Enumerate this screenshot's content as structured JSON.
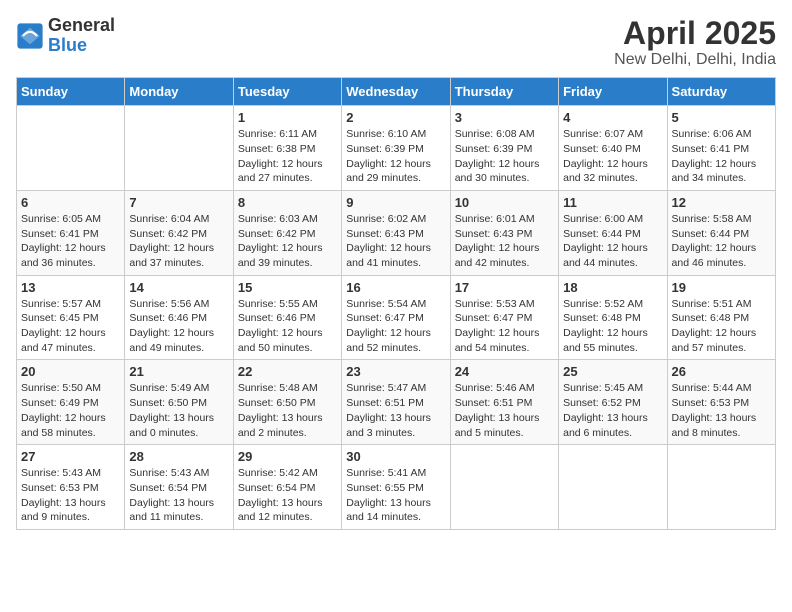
{
  "header": {
    "logo_text_general": "General",
    "logo_text_blue": "Blue",
    "title": "April 2025",
    "subtitle": "New Delhi, Delhi, India"
  },
  "calendar": {
    "days_of_week": [
      "Sunday",
      "Monday",
      "Tuesday",
      "Wednesday",
      "Thursday",
      "Friday",
      "Saturday"
    ],
    "weeks": [
      [
        {
          "day": "",
          "info": ""
        },
        {
          "day": "",
          "info": ""
        },
        {
          "day": "1",
          "sunrise": "6:11 AM",
          "sunset": "6:38 PM",
          "daylight": "12 hours and 27 minutes."
        },
        {
          "day": "2",
          "sunrise": "6:10 AM",
          "sunset": "6:39 PM",
          "daylight": "12 hours and 29 minutes."
        },
        {
          "day": "3",
          "sunrise": "6:08 AM",
          "sunset": "6:39 PM",
          "daylight": "12 hours and 30 minutes."
        },
        {
          "day": "4",
          "sunrise": "6:07 AM",
          "sunset": "6:40 PM",
          "daylight": "12 hours and 32 minutes."
        },
        {
          "day": "5",
          "sunrise": "6:06 AM",
          "sunset": "6:41 PM",
          "daylight": "12 hours and 34 minutes."
        }
      ],
      [
        {
          "day": "6",
          "sunrise": "6:05 AM",
          "sunset": "6:41 PM",
          "daylight": "12 hours and 36 minutes."
        },
        {
          "day": "7",
          "sunrise": "6:04 AM",
          "sunset": "6:42 PM",
          "daylight": "12 hours and 37 minutes."
        },
        {
          "day": "8",
          "sunrise": "6:03 AM",
          "sunset": "6:42 PM",
          "daylight": "12 hours and 39 minutes."
        },
        {
          "day": "9",
          "sunrise": "6:02 AM",
          "sunset": "6:43 PM",
          "daylight": "12 hours and 41 minutes."
        },
        {
          "day": "10",
          "sunrise": "6:01 AM",
          "sunset": "6:43 PM",
          "daylight": "12 hours and 42 minutes."
        },
        {
          "day": "11",
          "sunrise": "6:00 AM",
          "sunset": "6:44 PM",
          "daylight": "12 hours and 44 minutes."
        },
        {
          "day": "12",
          "sunrise": "5:58 AM",
          "sunset": "6:44 PM",
          "daylight": "12 hours and 46 minutes."
        }
      ],
      [
        {
          "day": "13",
          "sunrise": "5:57 AM",
          "sunset": "6:45 PM",
          "daylight": "12 hours and 47 minutes."
        },
        {
          "day": "14",
          "sunrise": "5:56 AM",
          "sunset": "6:46 PM",
          "daylight": "12 hours and 49 minutes."
        },
        {
          "day": "15",
          "sunrise": "5:55 AM",
          "sunset": "6:46 PM",
          "daylight": "12 hours and 50 minutes."
        },
        {
          "day": "16",
          "sunrise": "5:54 AM",
          "sunset": "6:47 PM",
          "daylight": "12 hours and 52 minutes."
        },
        {
          "day": "17",
          "sunrise": "5:53 AM",
          "sunset": "6:47 PM",
          "daylight": "12 hours and 54 minutes."
        },
        {
          "day": "18",
          "sunrise": "5:52 AM",
          "sunset": "6:48 PM",
          "daylight": "12 hours and 55 minutes."
        },
        {
          "day": "19",
          "sunrise": "5:51 AM",
          "sunset": "6:48 PM",
          "daylight": "12 hours and 57 minutes."
        }
      ],
      [
        {
          "day": "20",
          "sunrise": "5:50 AM",
          "sunset": "6:49 PM",
          "daylight": "12 hours and 58 minutes."
        },
        {
          "day": "21",
          "sunrise": "5:49 AM",
          "sunset": "6:50 PM",
          "daylight": "13 hours and 0 minutes."
        },
        {
          "day": "22",
          "sunrise": "5:48 AM",
          "sunset": "6:50 PM",
          "daylight": "13 hours and 2 minutes."
        },
        {
          "day": "23",
          "sunrise": "5:47 AM",
          "sunset": "6:51 PM",
          "daylight": "13 hours and 3 minutes."
        },
        {
          "day": "24",
          "sunrise": "5:46 AM",
          "sunset": "6:51 PM",
          "daylight": "13 hours and 5 minutes."
        },
        {
          "day": "25",
          "sunrise": "5:45 AM",
          "sunset": "6:52 PM",
          "daylight": "13 hours and 6 minutes."
        },
        {
          "day": "26",
          "sunrise": "5:44 AM",
          "sunset": "6:53 PM",
          "daylight": "13 hours and 8 minutes."
        }
      ],
      [
        {
          "day": "27",
          "sunrise": "5:43 AM",
          "sunset": "6:53 PM",
          "daylight": "13 hours and 9 minutes."
        },
        {
          "day": "28",
          "sunrise": "5:43 AM",
          "sunset": "6:54 PM",
          "daylight": "13 hours and 11 minutes."
        },
        {
          "day": "29",
          "sunrise": "5:42 AM",
          "sunset": "6:54 PM",
          "daylight": "13 hours and 12 minutes."
        },
        {
          "day": "30",
          "sunrise": "5:41 AM",
          "sunset": "6:55 PM",
          "daylight": "13 hours and 14 minutes."
        },
        {
          "day": "",
          "info": ""
        },
        {
          "day": "",
          "info": ""
        },
        {
          "day": "",
          "info": ""
        }
      ]
    ]
  }
}
